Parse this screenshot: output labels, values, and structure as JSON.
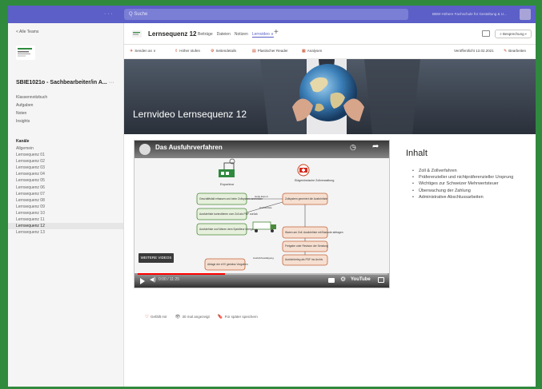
{
  "topbar": {
    "search_placeholder": "Q Suche",
    "user_text": "BBW-Höhere Fachschule für Gestaltung & U...",
    "more": "· · ·"
  },
  "sidebar": {
    "back_label": "< Alle Teams",
    "team_name": "SBIE1021o - Sachbearbeiter/in A...",
    "team_more": "···",
    "links": [
      "Klassennotizbuch",
      "Aufgaben",
      "Noten",
      "Insights"
    ],
    "channels_title": "Kanäle",
    "channels": [
      "Allgemein",
      "Lernsequenz 01",
      "Lernsequenz 02",
      "Lernsequenz 03",
      "Lernsequenz 04",
      "Lernsequenz 05",
      "Lernsequenz 06",
      "Lernsequenz 07",
      "Lernsequenz 08",
      "Lernsequenz 09",
      "Lernsequenz 10",
      "Lernsequenz 11",
      "Lernsequenz 12",
      "Lernsequenz 13"
    ],
    "active_channel": "Lernsequenz 12"
  },
  "channel_header": {
    "title": "Lernsequenz 12",
    "tabs": [
      "Beiträge",
      "Dateien",
      "Notizen",
      "Lernvideo"
    ],
    "active_tab": "Lernvideo",
    "add_tab": "+",
    "discussion_button": "⌕ Besprechung ▾"
  },
  "page_toolbar": {
    "send": "Senden an ∨",
    "promote": "Höher stufen",
    "page_details": "Seitendetails",
    "immersive_reader": "Plastischer Reader",
    "analytics": "Analysen",
    "published": "Veröffentlicht 13.02.2021",
    "edit": "Bearbeiten"
  },
  "hero": {
    "title": "Lernvideo Lernsequenz 12"
  },
  "video": {
    "title": "Das Ausfuhrverfahren",
    "diagram": {
      "exporter": "Exporteur",
      "customs": "Eidgenössische Zollverwaltung",
      "box1": "Geschäftsfall erfassen und beim Zollsystem anmelden",
      "box2": "Ausfuhrliste kontrollieren vom Zoll als PDF zurück",
      "box3": "Ausfuhrliste und Waren dem Spediteur übergeben",
      "box4": "Zollsystem generiert die Ausfuhrliste",
      "box5": "Waren am Zoll. Ausfuhrliste mit Barcode abfragen",
      "box6": "Freigabe oder Revision der Sendung",
      "box7": "Ausfuhrbeleg als PDF ins Archiv",
      "box8": "Ablage der eVV gemäss Vorgaben",
      "label_import": "siehe Export",
      "label_list": "Ausfuhrliste",
      "label_receipt": "Ausfuhrbestätigung"
    },
    "more_videos": "WEITERE VIDEOS",
    "time": "0:00 / 11:25",
    "youtube": "YouTube",
    "progress": 0.35
  },
  "inhalt": {
    "title": "Inhalt",
    "items": [
      "Zoll & Zollverfahren",
      "Präferenzieller und nichtpräferenzieller Ursprung",
      "Wichtiges zur Schweizer Mehrwertsteuer",
      "Überwachung der Zahlung",
      "Administrative Abschlussarbeiten"
    ]
  },
  "reactions": {
    "like": "Gefällt mir",
    "views": "30 mal angezeigt",
    "save": "Für später speichern"
  },
  "colors": {
    "accent": "#5b5fc7",
    "frame": "#2f8a3e",
    "alert": "#c43e1c"
  }
}
